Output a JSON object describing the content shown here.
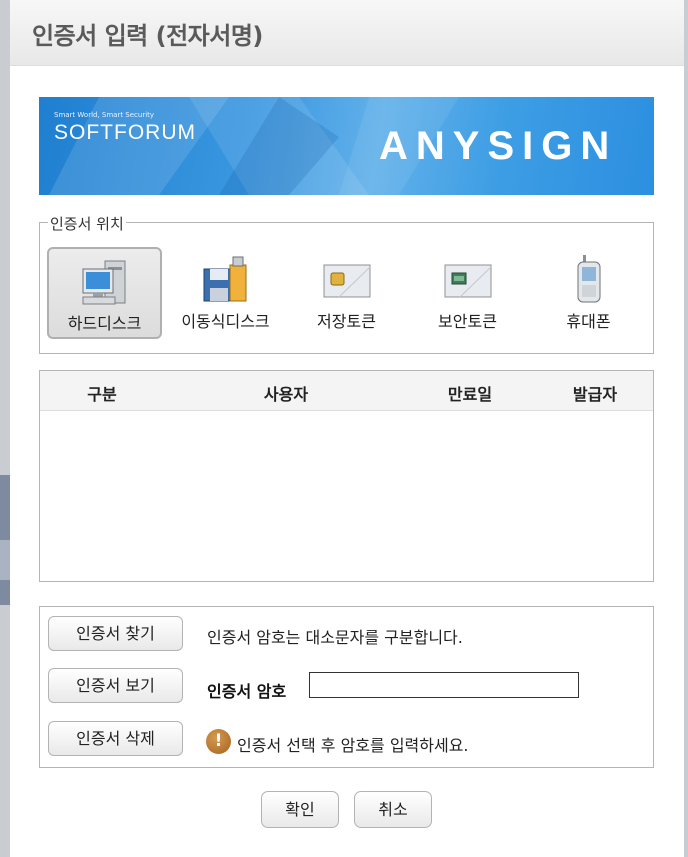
{
  "dialog": {
    "title": "인증서 입력 (전자서명)"
  },
  "banner": {
    "tagline": "Smart World, Smart Security",
    "brand": "SOFTFORUM",
    "product": "ANYSIGN"
  },
  "location": {
    "legend": "인증서 위치",
    "items": [
      {
        "label": "하드디스크",
        "icon": "hard-disk-icon",
        "selected": true
      },
      {
        "label": "이동식디스크",
        "icon": "removable-disk-icon",
        "selected": false
      },
      {
        "label": "저장토큰",
        "icon": "storage-token-icon",
        "selected": false
      },
      {
        "label": "보안토큰",
        "icon": "security-token-icon",
        "selected": false
      },
      {
        "label": "휴대폰",
        "icon": "mobile-phone-icon",
        "selected": false
      }
    ]
  },
  "cert_table": {
    "columns": [
      "구분",
      "사용자",
      "만료일",
      "발급자"
    ],
    "rows": []
  },
  "actions": {
    "find_button": "인증서 찾기",
    "view_button": "인증서 보기",
    "delete_button": "인증서 삭제",
    "case_note": "인증서 암호는 대소문자를 구분합니다.",
    "password_label": "인증서 암호",
    "password_value": "",
    "warning_text": "인증서 선택 후 암호를 입력하세요.",
    "warning_icon": "warning-icon"
  },
  "footer": {
    "ok_button": "확인",
    "cancel_button": "취소"
  }
}
